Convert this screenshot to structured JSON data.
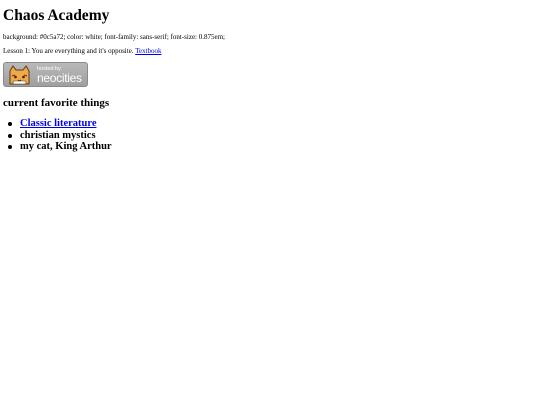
{
  "site": {
    "title": "Chaos Academy",
    "css_note": "background: #0c5a72; color: white; font-family: sans-serif; font-size: 0.875em;"
  },
  "lesson": {
    "text": "Lesson 1: You are everything and it's opposite.",
    "link_label": "Textbook"
  },
  "badge": {
    "small_text": "hosted by",
    "brand_text": "neocities",
    "icon": "neocities-cat-icon"
  },
  "favorites": {
    "heading": "current favorite things",
    "items": [
      {
        "label": "Classic literature",
        "is_link": true
      },
      {
        "label": "christian mystics",
        "is_link": false
      },
      {
        "label": "my cat, King Arthur",
        "is_link": false
      }
    ]
  },
  "colors": {
    "link": "#0000ee",
    "text": "#000000",
    "background": "#ffffff",
    "badge_bg": "#a9a9a9"
  }
}
